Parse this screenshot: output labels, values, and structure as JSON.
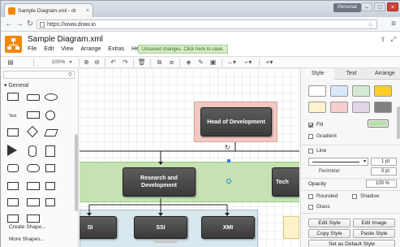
{
  "browser": {
    "tab_title": "Sample Diagram.xml - dr",
    "tab_close": "×",
    "profile": "Personal",
    "window_buttons": [
      "–",
      "□",
      "×"
    ],
    "url": "https://www.draw.io"
  },
  "app": {
    "document_title": "Sample Diagram.xml",
    "menu": [
      "File",
      "Edit",
      "View",
      "Arrange",
      "Extras",
      "Help"
    ],
    "unsaved_notice": "Unsaved changes. Click here to save.",
    "zoom": "100%"
  },
  "sidebar": {
    "search_placeholder": "",
    "section_title": "General",
    "text_shape_label": "Text",
    "create_shape": "Create Shape...",
    "more_shapes": "More Shapes..."
  },
  "diagram": {
    "head": "Head of Development",
    "rd": "Research and Development",
    "tech_partial": "Tech",
    "si": "SI",
    "ssi": "SSI",
    "xmi": "XMI"
  },
  "panel": {
    "tabs": [
      "Style",
      "Text",
      "Arrange"
    ],
    "swatch_colors": [
      "#ffffff",
      "#dae8fc",
      "#d5e8d4",
      "#ffcd28",
      "#fff2cc",
      "#f8cecc",
      "#e1d5e7",
      "#808080"
    ],
    "fill_label": "Fill",
    "fill_color": "#b9e0a5",
    "gradient_label": "Gradient",
    "line_label": "Line",
    "line_width": "1 pt",
    "perimeter_label": "Perimeter",
    "perimeter_value": "0 pt",
    "opacity_label": "Opacity",
    "opacity_value": "100 %",
    "rounded_label": "Rounded",
    "shadow_label": "Shadow",
    "glass_label": "Glass",
    "edit_style": "Edit Style",
    "edit_image": "Edit Image",
    "copy_style": "Copy Style",
    "paste_style": "Paste Style",
    "set_default": "Set as Default Style"
  }
}
